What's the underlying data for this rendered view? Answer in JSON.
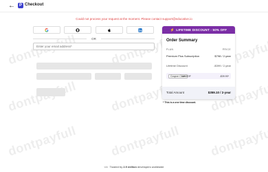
{
  "watermark": "dontpayfull",
  "header": {
    "back_icon": "arrow-left-icon",
    "logo_glyph": "P",
    "title": "Checkout"
  },
  "alert": {
    "text": "Could not process your request at the moment. Please contact support@educative.io"
  },
  "sso": {
    "buttons": [
      "google-icon",
      "github-icon",
      "apple-icon",
      "linkedin-icon"
    ]
  },
  "divider": "OR",
  "email": {
    "placeholder": "Enter your email address*"
  },
  "order_summary": {
    "deal_banner": "LIFETIME DISCOUNT - 50% OFF",
    "title": "Order Summary",
    "plan_header": "PLAN",
    "price_header": "PRICE",
    "plan_name": "Premium Plus Subscription",
    "plan_price": "$798 / 2-year",
    "discount_label": "Lifetime Discount",
    "discount_value": "-$399 / 2-year",
    "coupon_label": "Coupon Code",
    "coupon_code": "3-HWOF",
    "coupon_value": "-$39.90*",
    "total_label": "Total Amount",
    "total_value": "$359.10 / 2-year",
    "accent_color": "#7b2ea6"
  },
  "note": "* This is a one time discount.",
  "footer": {
    "prefix": "Trusted by",
    "bold": "2.9 million",
    "suffix": "developers worldwide"
  }
}
